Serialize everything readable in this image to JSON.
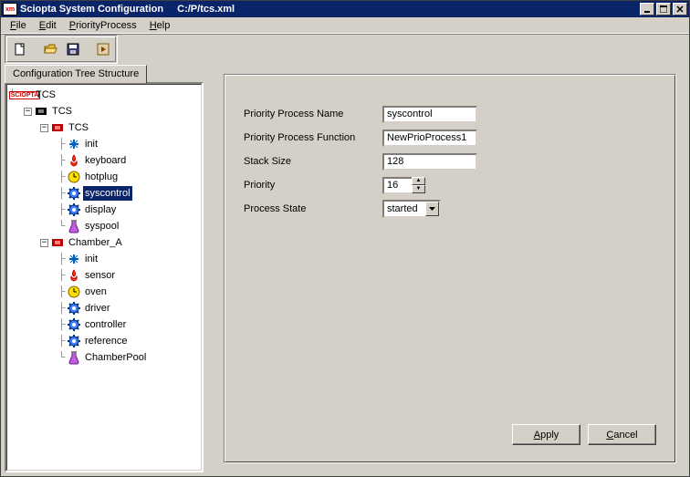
{
  "title": {
    "app": "Sciopta System Configuration",
    "path": "C:/P/tcs.xml"
  },
  "menus": {
    "file": "File",
    "edit": "Edit",
    "priorityProcess": "PriorityProcess",
    "help": "Help"
  },
  "tab": {
    "label": "Configuration Tree Structure"
  },
  "tree": {
    "root": "TCS",
    "module_root": "TCS",
    "sub1": {
      "name": "TCS",
      "children": [
        {
          "label": "init",
          "icon": "init"
        },
        {
          "label": "keyboard",
          "icon": "flame"
        },
        {
          "label": "hotplug",
          "icon": "clock"
        },
        {
          "label": "syscontrol",
          "icon": "gear",
          "selected": true
        },
        {
          "label": "display",
          "icon": "gear"
        },
        {
          "label": "syspool",
          "icon": "flask"
        }
      ]
    },
    "sub2": {
      "name": "Chamber_A",
      "children": [
        {
          "label": "init",
          "icon": "init"
        },
        {
          "label": "sensor",
          "icon": "flame"
        },
        {
          "label": "oven",
          "icon": "clock"
        },
        {
          "label": "driver",
          "icon": "gear"
        },
        {
          "label": "controller",
          "icon": "gear"
        },
        {
          "label": "reference",
          "icon": "gear"
        },
        {
          "label": "ChamberPool",
          "icon": "flask"
        }
      ]
    }
  },
  "form": {
    "labels": {
      "name": "Priority Process Name",
      "func": "Priority Process Function",
      "stack": "Stack Size",
      "priority": "Priority",
      "state": "Process State"
    },
    "values": {
      "name": "syscontrol",
      "func": "NewPrioProcess1",
      "stack": "128",
      "priority": "16",
      "state": "started"
    }
  },
  "buttons": {
    "apply": "Apply",
    "cancel": "Cancel"
  }
}
